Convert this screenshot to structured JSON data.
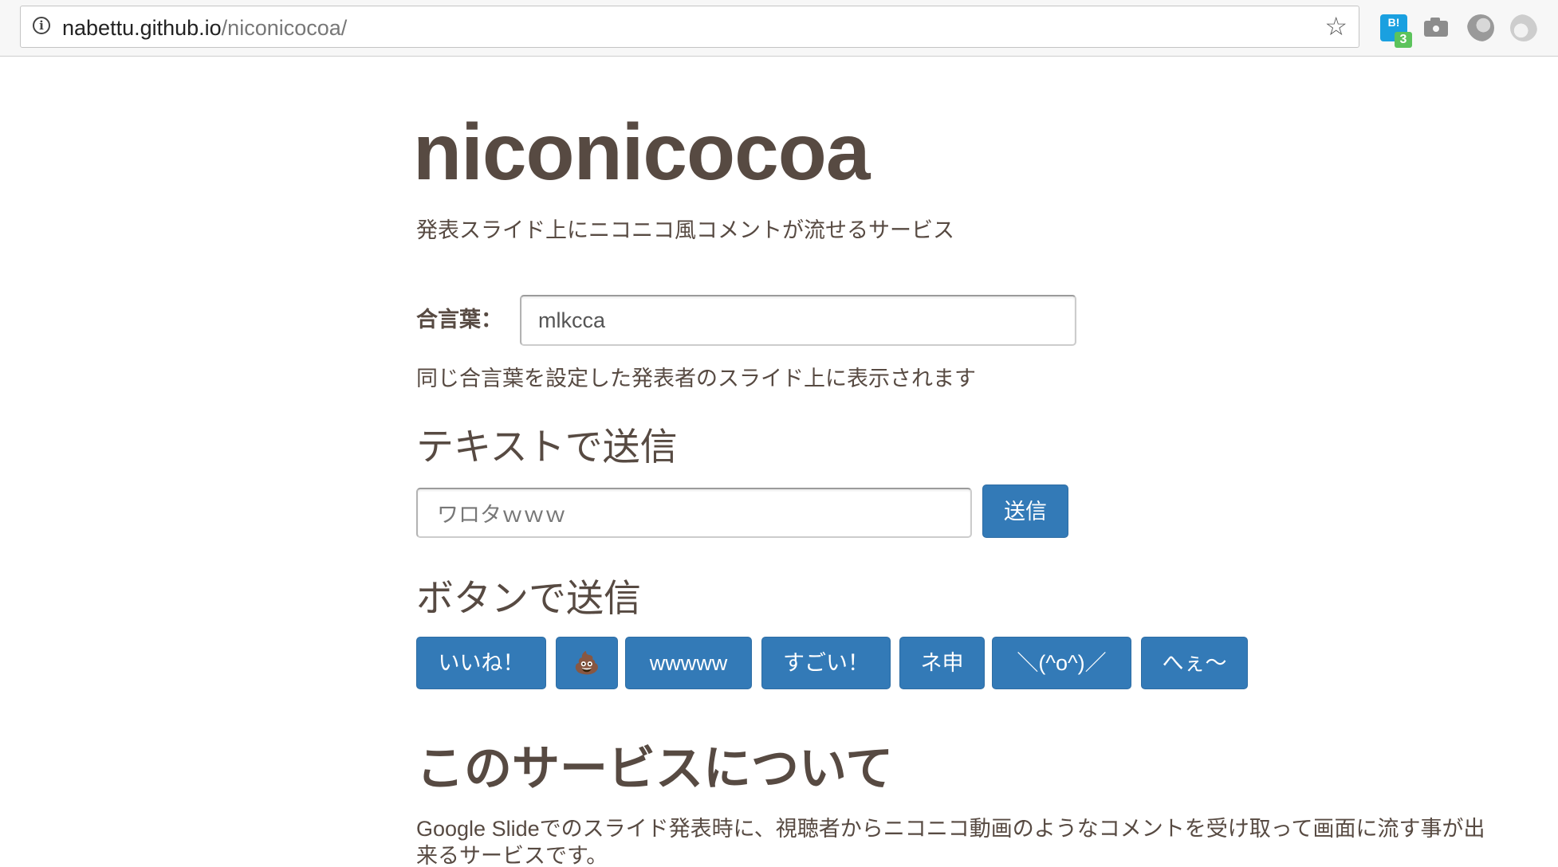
{
  "browser": {
    "url_host": "nabettu.github.io",
    "url_path": "/niconicocoa/",
    "info_icon": "i",
    "star_icon": "☆",
    "extension_badge_label": "B!",
    "extension_badge_count": "3"
  },
  "page": {
    "title": "niconicocoa",
    "subtitle": "発表スライド上にニコニコ風コメントが流せるサービス",
    "keyword_label": "合言葉：",
    "keyword_value": "mlkcca",
    "keyword_help": "同じ合言葉を設定した発表者のスライド上に表示されます",
    "text_section_heading": "テキストで送信",
    "text_input_value": "ワロタｗｗｗ",
    "send_label": "送信",
    "button_section_heading": "ボタンで送信",
    "quick_buttons": [
      "いいね！",
      "💩",
      "wwwww",
      "すごい！",
      "ネ申",
      "＼(^o^)／",
      "へぇ〜"
    ],
    "about_heading": "このサービスについて",
    "about_text": "Google Slideでのスライド発表時に、視聴者からニコニコ動画のようなコメントを受け取って画面に流す事が出来るサービスです。"
  },
  "colors": {
    "text": "#574a42",
    "button_bg": "#337ab7",
    "button_border": "#2e6da4",
    "button_text": "#ffffff"
  }
}
